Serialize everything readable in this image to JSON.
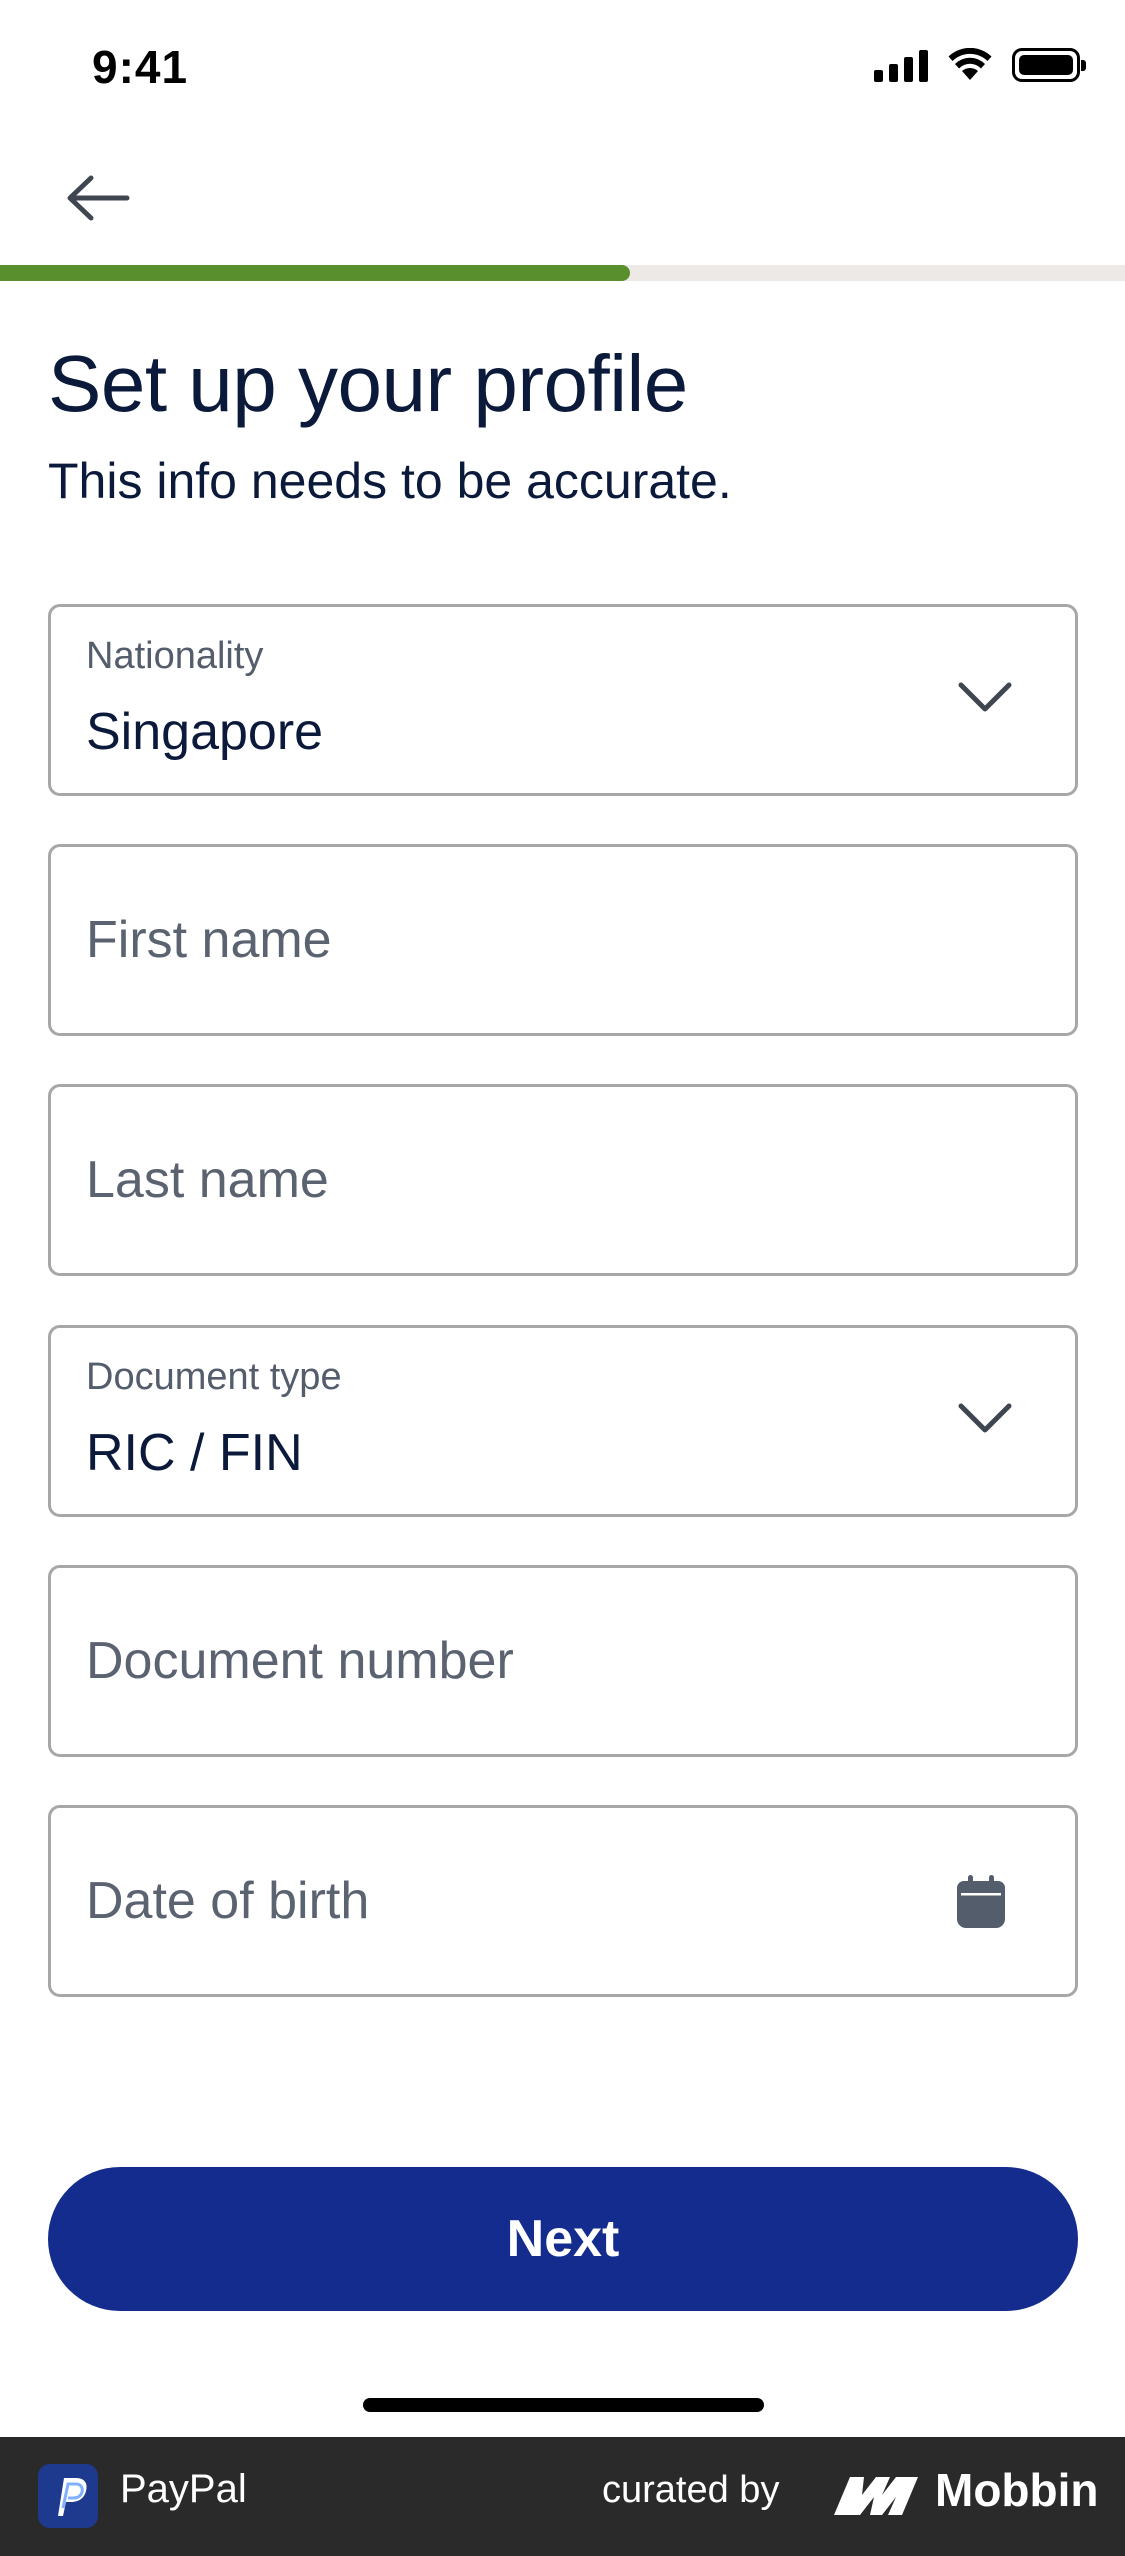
{
  "status_bar": {
    "time": "9:41"
  },
  "navigation": {
    "back_icon": "arrow-left-icon"
  },
  "progress": {
    "value": 0.56,
    "color": "#5a8f2e",
    "track_color": "#ece9e6"
  },
  "header": {
    "title": "Set up your profile",
    "subtitle": "This info needs to be accurate."
  },
  "form": {
    "nationality": {
      "label": "Nationality",
      "value": "Singapore",
      "icon": "chevron-down-icon"
    },
    "first_name": {
      "placeholder": "First name"
    },
    "last_name": {
      "placeholder": "Last name"
    },
    "document_type": {
      "label": "Document type",
      "value": "RIC / FIN",
      "icon": "chevron-down-icon"
    },
    "document_number": {
      "placeholder": "Document number"
    },
    "date_of_birth": {
      "placeholder": "Date of birth",
      "icon": "calendar-icon"
    }
  },
  "actions": {
    "next_label": "Next",
    "color": "#142c8e"
  },
  "footer": {
    "app_name": "PayPal",
    "curated_by": "curated by",
    "brand": "Mobbin"
  }
}
